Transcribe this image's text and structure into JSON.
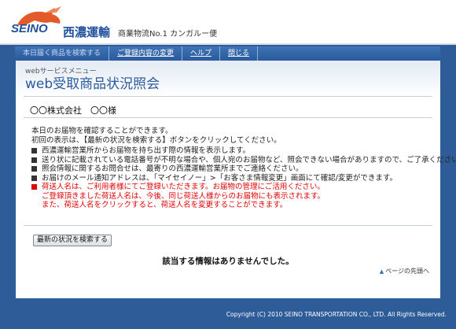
{
  "brand": {
    "logo_text": "SEINO",
    "company_name": "西濃運輸",
    "tagline": "商業物流No.1 カンガルー便"
  },
  "nav": {
    "items": [
      {
        "label": "本日届く商品を検索する"
      },
      {
        "label": "ご登録内容の変更"
      },
      {
        "label": "ヘルプ"
      },
      {
        "label": "閉じる"
      }
    ]
  },
  "page": {
    "menu_label": "webサービスメニュー",
    "title": "web受取商品状況照会",
    "user_name": "〇〇株式会社　〇〇様"
  },
  "messages": {
    "intro_1": "本日のお届物を確認することができます。",
    "intro_2": "初回の表示は、【最新の状況を検索する】ボタンをクリックしてください。",
    "bullets": [
      "西濃運輸営業所からお届物を持ち出す際の情報を表示します。",
      "送り状に記載されている電話番号が不明な場合や、個人宛のお届物など、照会できない場合がありますので、ご了承ください。",
      "照会情報に関するお問合せは、最寄りの西濃運輸営業所までご連絡ください。",
      "お届けのメール通知アドレスは、「マイセイノー」>「お客さま情報変更」画面にて確認/変更ができます。"
    ],
    "red_bullet": "荷送人名は、ご利用者様にてご登録いただきます。お届物の管理にご活用ください。",
    "red_line_2": "ご登録頂きました荷送人名は、今後、同じ荷送人様からのお届物にも表示されます。",
    "red_line_3": "また、荷送人名をクリックすると、荷送人名を変更することができます。"
  },
  "search_button": "最新の状況を検索する",
  "no_info": "該当する情報はありませんでした。",
  "to_top": "ページの先頭へ",
  "footer": "Copyright (C) 2010 SEINO TRANSPORTATION CO., LTD. All Rights Reserved.",
  "colors": {
    "brand_blue": "#1e4f9c",
    "nav_blue": "#2a5a9c",
    "page_bg": "#2d5c98",
    "alert_red": "#e00000"
  }
}
